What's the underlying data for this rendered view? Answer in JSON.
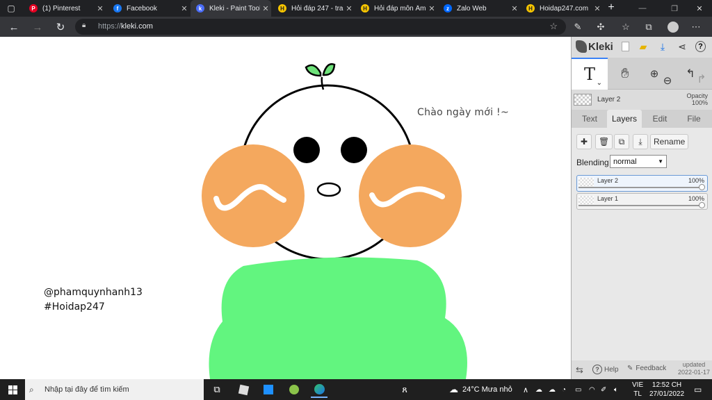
{
  "browser": {
    "tabs": [
      {
        "title": "(1) Pinterest",
        "icon": "pinterest-icon",
        "color": "#e60023",
        "active": false
      },
      {
        "title": "Facebook",
        "icon": "facebook-icon",
        "color": "#1877f2",
        "active": false
      },
      {
        "title": "Kleki - Paint Tool",
        "icon": "kleki-icon",
        "color": "#4a6cf7",
        "active": true
      },
      {
        "title": "Hỏi đáp 247 - tra",
        "icon": "hoidap-icon",
        "color": "#f5c400",
        "active": false
      },
      {
        "title": "Hỏi đáp môn Âm",
        "icon": "hoidap-icon",
        "color": "#f5c400",
        "active": false
      },
      {
        "title": "Zalo Web",
        "icon": "zalo-icon",
        "color": "#0068ff",
        "active": false
      },
      {
        "title": "Hoidap247.com",
        "icon": "hoidap-icon",
        "color": "#f5c400",
        "active": false
      }
    ],
    "url_scheme": "https://",
    "url_host": "kleki.com"
  },
  "canvas": {
    "greeting": "Chào ngày mới !~",
    "signature_line1": "@phamquynhanh13",
    "signature_line2": "#Hoidap247",
    "colors": {
      "cheek": "#f4a85e",
      "body": "#62f57f",
      "outline": "#000000",
      "sprout": "#6ee27a"
    }
  },
  "kleki": {
    "logo": "Kleki",
    "current_tool": "T",
    "layer_name": "Layer 2",
    "opacity_label": "Opacity",
    "opacity_value": "100%",
    "tabs": [
      "Text",
      "Layers",
      "Edit",
      "File"
    ],
    "active_tab": "Layers",
    "rename_label": "Rename",
    "blending_label": "Blending",
    "blending_value": "normal",
    "layers": [
      {
        "name": "Layer 2",
        "opacity": "100%",
        "selected": true
      },
      {
        "name": "Layer 1",
        "opacity": "100%",
        "selected": false
      }
    ],
    "footer": {
      "help": "Help",
      "feedback": "Feedback",
      "updated_label": "updated",
      "updated_date": "2022-01-17"
    }
  },
  "taskbar": {
    "search_placeholder": "Nhập tại đây để tìm kiếm",
    "weather": "24°C  Mưa nhỏ",
    "lang_line1": "VIE",
    "lang_line2": "TL",
    "time": "12:52 CH",
    "date": "27/01/2022"
  }
}
